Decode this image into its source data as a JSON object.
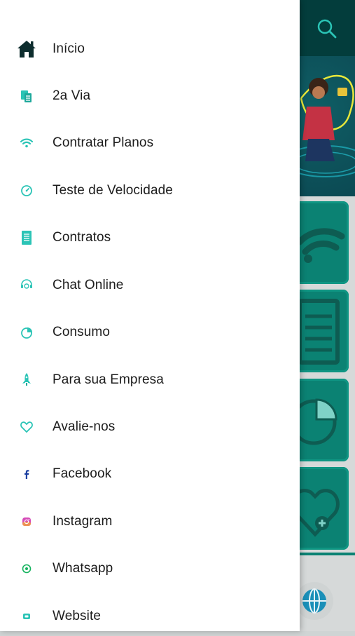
{
  "menu": {
    "items": [
      {
        "label": "Início",
        "icon": "home-icon"
      },
      {
        "label": "2a Via",
        "icon": "invoice-copy-icon"
      },
      {
        "label": "Contratar Planos",
        "icon": "wifi-icon"
      },
      {
        "label": "Teste de Velocidade",
        "icon": "speedometer-icon"
      },
      {
        "label": "Contratos",
        "icon": "document-icon"
      },
      {
        "label": "Chat Online",
        "icon": "chat-icon"
      },
      {
        "label": "Consumo",
        "icon": "pie-chart-icon"
      },
      {
        "label": "Para sua Empresa",
        "icon": "rocket-icon"
      },
      {
        "label": "Avalie-nos",
        "icon": "heart-icon"
      },
      {
        "label": "Facebook",
        "icon": "facebook-icon"
      },
      {
        "label": "Instagram",
        "icon": "instagram-icon"
      },
      {
        "label": "Whatsapp",
        "icon": "whatsapp-icon"
      },
      {
        "label": "Website",
        "icon": "website-icon"
      }
    ]
  },
  "background": {
    "tiles": [
      "wifi-icon",
      "document-icon",
      "pie-chart-icon",
      "heart-icon"
    ]
  },
  "colors": {
    "accent": "#2bc4b6",
    "top_bar": "#033d3c",
    "tile": "#0b8273",
    "home_icon": "#0d2d2e",
    "facebook": "#1b3fa0",
    "instagram": "#c13ab5",
    "whatsapp": "#16b35f"
  }
}
